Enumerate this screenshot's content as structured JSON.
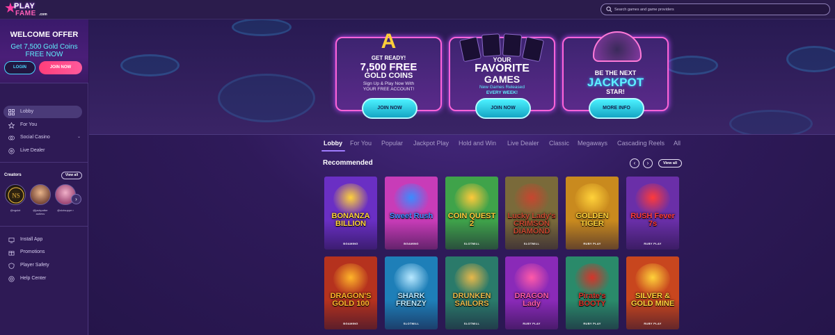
{
  "header": {
    "logo": {
      "line1": "PLAY",
      "line2": "FAME",
      "suffix": ".com"
    },
    "search_placeholder": "Search games and game providers"
  },
  "sidebar": {
    "offer": {
      "title": "WELCOME OFFER",
      "line1": "Get 7,500 Gold Coins",
      "line2": "FREE NOW"
    },
    "login_label": "LOGIN",
    "join_label": "JOIN NOW",
    "nav": [
      {
        "label": "Lobby",
        "icon": "grid-icon",
        "active": true
      },
      {
        "label": "For You",
        "icon": "star-icon"
      },
      {
        "label": "Social Casino",
        "icon": "chips-icon",
        "has_chevron": true
      },
      {
        "label": "Live Dealer",
        "icon": "dealer-icon"
      }
    ],
    "creators_title": "Creators",
    "creators_viewall": "View all",
    "creators": [
      {
        "name": "@ngslot"
      },
      {
        "name": "@jackpotter autiesv"
      },
      {
        "name": "@slotsuppe r"
      }
    ],
    "bottom_links": [
      {
        "label": "Install App",
        "icon": "install-icon"
      },
      {
        "label": "Promotions",
        "icon": "promo-icon"
      },
      {
        "label": "Player Safety",
        "icon": "safety-icon"
      },
      {
        "label": "Help Center",
        "icon": "help-icon"
      }
    ]
  },
  "promos": [
    {
      "line1": "GET READY!",
      "line2": "7,500 FREE",
      "line3": "GOLD COINS",
      "line4": "Sign Up & Play Now With",
      "line5": "YOUR FREE ACCOUNT!",
      "cta": "JOIN NOW"
    },
    {
      "line1": "YOUR",
      "line2": "FAVORITE",
      "line3": "GAMES",
      "line4": "New Games Released",
      "line5": "EVERY WEEK!",
      "cta": "JOIN NOW"
    },
    {
      "line1": "BE THE NEXT",
      "line2": "JACKPOT",
      "line3": "STAR!",
      "cta": "MORE INFO"
    }
  ],
  "tabs": [
    "Lobby",
    "For You",
    "Popular",
    "Jackpot Play",
    "Hold and Win",
    "Live Dealer",
    "Classic",
    "Megaways",
    "Cascading Reels",
    "All"
  ],
  "recommended": {
    "title": "Recommended",
    "viewall": "View all",
    "prev_icon": "chevron-left-icon",
    "next_icon": "chevron-right-icon"
  },
  "games": [
    {
      "title": "BONANZA BILLION",
      "provider": "BGAMING",
      "bg": "#6a2fc4",
      "accent": "#ffd23a"
    },
    {
      "title": "Sweet Rush",
      "provider": "BGAMING",
      "bg": "#c83cb8",
      "accent": "#3a8cff"
    },
    {
      "title": "COIN QUEST 2",
      "provider": "SLOTMILL",
      "bg": "#3fa34a",
      "accent": "#ffc93a"
    },
    {
      "title": "Lucky Lady's CRIMSON DIAMOND",
      "provider": "SLOTMILL",
      "bg": "#7a6a3a",
      "accent": "#c7462f"
    },
    {
      "title": "GOLDEN TIGER",
      "provider": "RUBY PLAY",
      "bg": "#c98a1e",
      "accent": "#ffd23a"
    },
    {
      "title": "RUSH Fever 7s",
      "provider": "RUBY PLAY",
      "bg": "#6a2fa8",
      "accent": "#ff3a3a"
    },
    {
      "title": "DRAGON'S GOLD 100",
      "provider": "BGAMING",
      "bg": "#b5321e",
      "accent": "#ffb52a"
    },
    {
      "title": "SHARK FRENZY",
      "provider": "SLOTMILL",
      "bg": "#1e7fb8",
      "accent": "#b8e8ff"
    },
    {
      "title": "DRUNKEN SAILORS",
      "provider": "SLOTMILL",
      "bg": "#2a7a6a",
      "accent": "#e8b84a"
    },
    {
      "title": "DRAGON Lady",
      "provider": "RUBY PLAY",
      "bg": "#8a2ab8",
      "accent": "#ff5aa8"
    },
    {
      "title": "Pirate's BOOTY",
      "provider": "RUBY PLAY",
      "bg": "#2a8a6a",
      "accent": "#d6342a"
    },
    {
      "title": "SILVER & GOLD MINE",
      "provider": "RUBY PLAY",
      "bg": "#c8461e",
      "accent": "#ffd23a"
    }
  ]
}
